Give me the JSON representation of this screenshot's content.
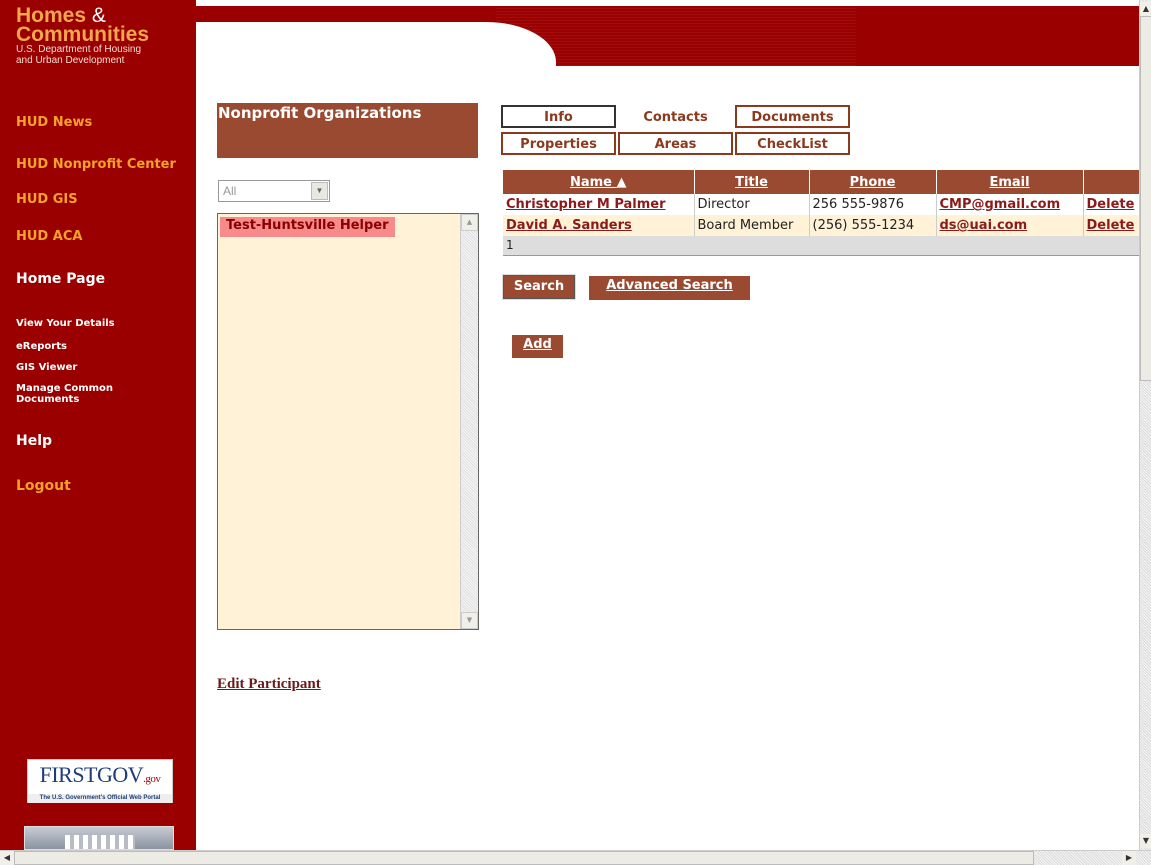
{
  "brand": {
    "line1": "Homes",
    "amp": "&",
    "line2": "Communities",
    "line3": "U.S. Department of Housing",
    "line4": "and Urban Development"
  },
  "sidebar": {
    "items": [
      {
        "label": "HUD News"
      },
      {
        "label": "HUD Nonprofit Center"
      },
      {
        "label": "HUD GIS"
      },
      {
        "label": "HUD ACA"
      },
      {
        "label": "Home Page"
      },
      {
        "label": "View Your Details"
      },
      {
        "label": "eReports"
      },
      {
        "label": "GIS Viewer"
      },
      {
        "label": "Manage Common Documents"
      },
      {
        "label": "Help"
      },
      {
        "label": "Logout"
      }
    ],
    "firstgov": {
      "main": "FIRSTGOV",
      "suffix": ".gov",
      "tagline": "The U.S. Government's Official Web Portal"
    }
  },
  "panel": {
    "title": "Nonprofit Organizations",
    "filter_value": "All",
    "list_items": [
      "Test-Huntsville Helper"
    ],
    "edit_link": "Edit Participant"
  },
  "tabs": {
    "info": "Info",
    "contacts": "Contacts",
    "documents": "Documents",
    "properties": "Properties",
    "areas": "Areas",
    "checklist": "CheckList"
  },
  "grid": {
    "columns": {
      "name": "Name",
      "title": "Title",
      "phone": "Phone",
      "email": "Email",
      "action": ""
    },
    "sort_indicator": "▲",
    "rows": [
      {
        "name": "Christopher M Palmer",
        "title": "Director",
        "phone": "256 555-9876",
        "email": "CMP@gmail.com",
        "action": "Delete"
      },
      {
        "name": "David A. Sanders",
        "title": "Board Member",
        "phone": "(256) 555-1234",
        "email": "ds@uai.com",
        "action": "Delete"
      }
    ],
    "pager": "1"
  },
  "buttons": {
    "search": "Search",
    "advanced_search": "Advanced Search",
    "add": "Add"
  },
  "colors": {
    "sidebar_red": "#9b0000",
    "accent_brown": "#9b4a32",
    "nav_orange": "#f5a12a",
    "list_bg": "#fff2d6"
  }
}
